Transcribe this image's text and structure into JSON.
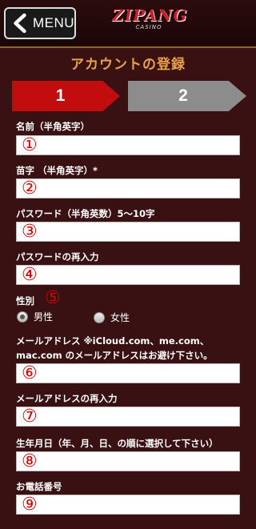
{
  "header": {
    "menu_label": "MENU",
    "logo_text": "ZIPANG",
    "logo_sub": "CASINO"
  },
  "page_title": "アカウントの登録",
  "steps": [
    {
      "label": "1",
      "active": true,
      "color": "#c20d0e"
    },
    {
      "label": "2",
      "active": false,
      "color": "#8c8c8c"
    }
  ],
  "fields": {
    "first_name": {
      "label": "名前（半角英字）",
      "marker": "①",
      "value": ""
    },
    "last_name": {
      "label": "苗字 （半角英字）*",
      "marker": "②",
      "value": ""
    },
    "password": {
      "label": "パスワード（半角英数）5〜10字",
      "marker": "③",
      "value": ""
    },
    "password_confirm": {
      "label": "パスワードの再入力",
      "marker": "④",
      "value": ""
    },
    "gender": {
      "label": "性別",
      "marker": "⑤",
      "options": [
        "男性",
        "女性"
      ],
      "selected": "男性"
    },
    "email": {
      "label_line1": "メールアドレス ※iCloud.com、me.com、",
      "label_line2": "mac.com のメールアドレスはお避け下さい。",
      "marker": "⑥",
      "value": ""
    },
    "email_confirm": {
      "label": "メールアドレスの再入力",
      "marker": "⑦",
      "value": ""
    },
    "birthdate": {
      "label": "生年月日（年、月、日、の順に選択して下さい）",
      "marker": "⑧",
      "value": ""
    },
    "phone": {
      "label": "お電話番号",
      "marker": "⑨",
      "value": ""
    }
  },
  "colors": {
    "background": "#3a1113",
    "title": "#e8a24a",
    "marker": "#d40000"
  }
}
